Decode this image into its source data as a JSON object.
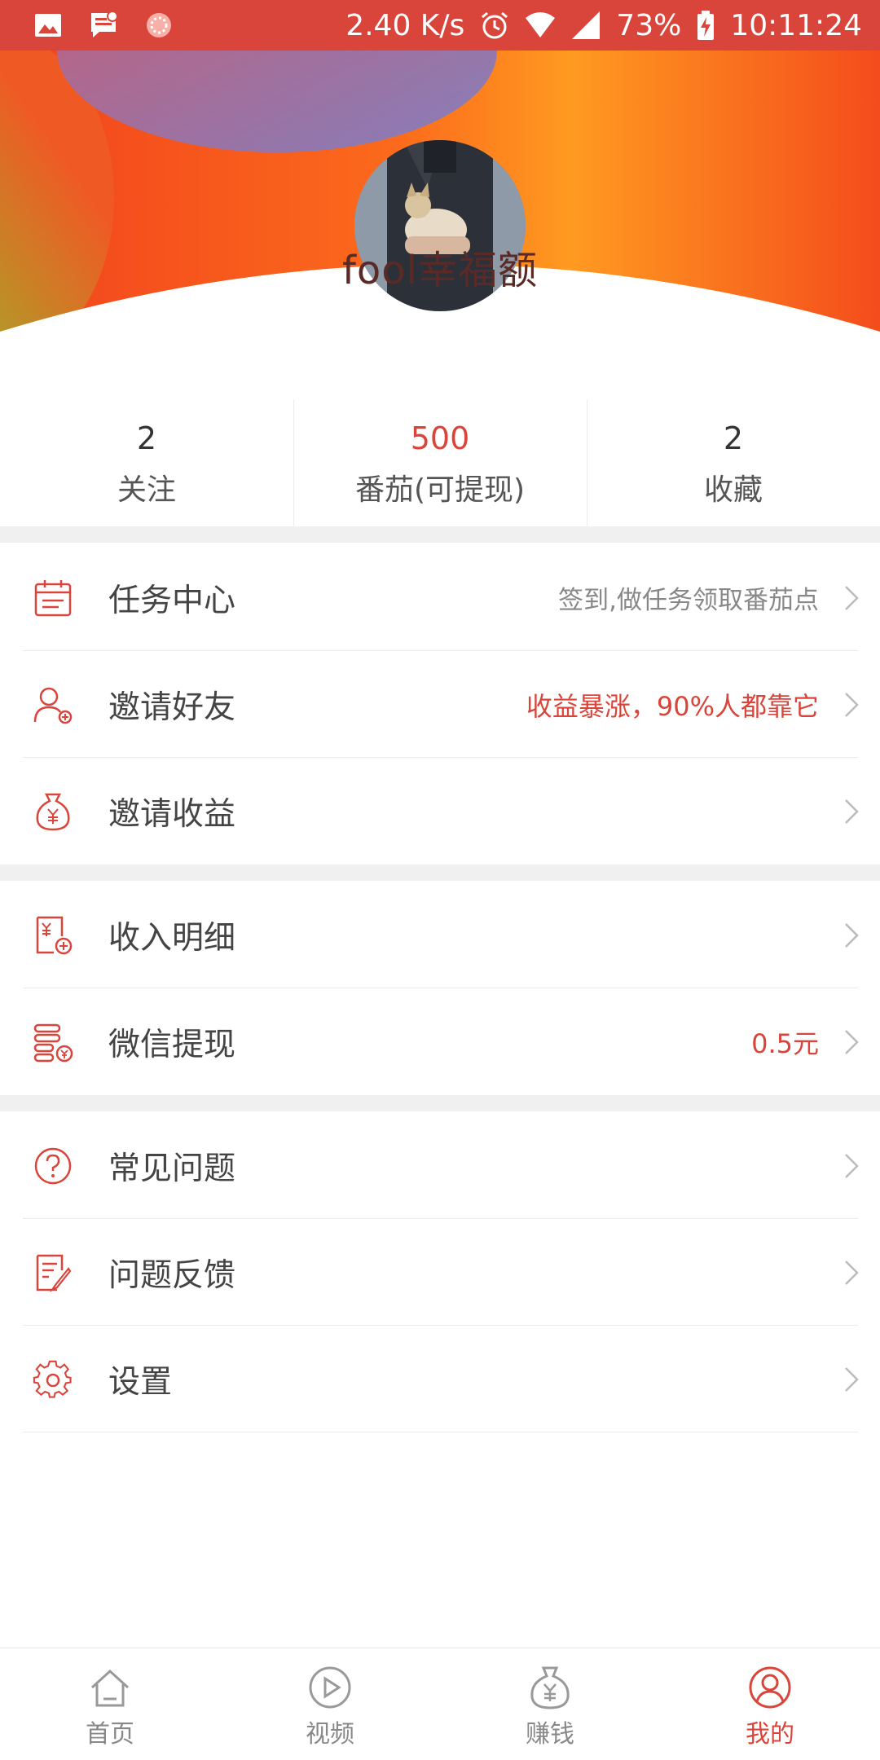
{
  "status_bar": {
    "speed": "2.40 K/s",
    "battery": "73%",
    "time": "10:11:24"
  },
  "profile": {
    "username": "fool幸福额"
  },
  "stats": [
    {
      "value": "2",
      "label": "关注"
    },
    {
      "value": "500",
      "label": "番茄(可提现)"
    },
    {
      "value": "2",
      "label": "收藏"
    }
  ],
  "menu": {
    "group1": [
      {
        "label": "任务中心",
        "hint": "签到,做任务领取番茄点",
        "icon": "calendar-icon"
      },
      {
        "label": "邀请好友",
        "hint": "收益暴涨，90%人都靠它",
        "icon": "invite-user-icon"
      },
      {
        "label": "邀请收益",
        "hint": "",
        "icon": "money-bag-icon"
      }
    ],
    "group2": [
      {
        "label": "收入明细",
        "hint": "",
        "icon": "income-detail-icon"
      },
      {
        "label": "微信提现",
        "hint": "0.5元",
        "icon": "coins-withdraw-icon"
      }
    ],
    "group3": [
      {
        "label": "常见问题",
        "hint": "",
        "icon": "question-icon"
      },
      {
        "label": "问题反馈",
        "hint": "",
        "icon": "feedback-icon"
      },
      {
        "label": "设置",
        "hint": "",
        "icon": "settings-gear-icon"
      }
    ]
  },
  "bottom_nav": [
    {
      "label": "首页",
      "icon": "home-icon",
      "active": false
    },
    {
      "label": "视频",
      "icon": "play-icon",
      "active": false
    },
    {
      "label": "赚钱",
      "icon": "money-bag-icon",
      "active": false
    },
    {
      "label": "我的",
      "icon": "user-circle-icon",
      "active": true
    }
  ],
  "colors": {
    "accent": "#d9453b",
    "header_orange": "#ff7a1a",
    "header_red": "#f24a1f",
    "text_dark": "#444444",
    "hint_gray": "#888888"
  }
}
